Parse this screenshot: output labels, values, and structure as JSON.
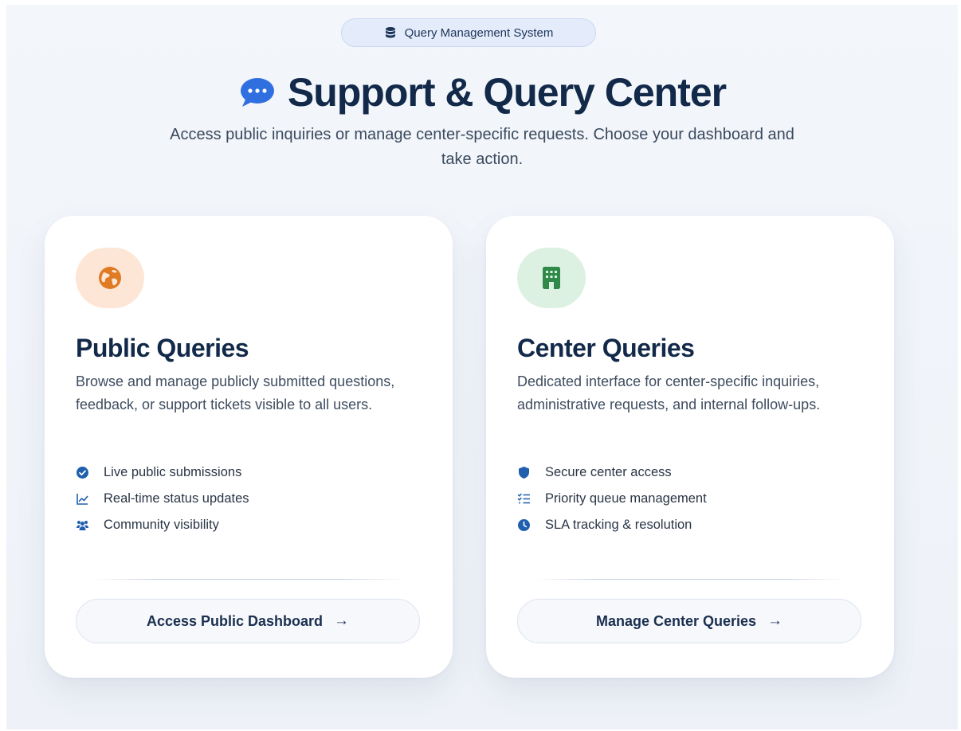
{
  "badge": {
    "label": "Query Management System",
    "icon": "database-icon"
  },
  "hero": {
    "title": "Support & Query Center",
    "icon": "chat-bubble-icon",
    "subtitle": "Access public inquiries or manage center-specific requests. Choose your dashboard and take action."
  },
  "cards": {
    "public": {
      "icon": "globe-icon",
      "title": "Public Queries",
      "description": "Browse and manage publicly submitted questions, feedback, or support tickets visible to all users.",
      "features": [
        {
          "icon": "check-circle-icon",
          "label": "Live public submissions"
        },
        {
          "icon": "line-chart-icon",
          "label": "Real-time status updates"
        },
        {
          "icon": "users-icon",
          "label": "Community visibility"
        }
      ],
      "button_label": "Access Public Dashboard",
      "button_arrow": "→"
    },
    "center": {
      "icon": "building-icon",
      "title": "Center Queries",
      "description": "Dedicated interface for center-specific inquiries, administrative requests, and internal follow-ups.",
      "features": [
        {
          "icon": "shield-icon",
          "label": "Secure center access"
        },
        {
          "icon": "checklist-icon",
          "label": "Priority queue management"
        },
        {
          "icon": "clock-icon",
          "label": "SLA tracking & resolution"
        }
      ],
      "button_label": "Manage Center Queries",
      "button_arrow": "→"
    }
  },
  "colors": {
    "heading": "#12294a",
    "accent_blue": "#2f6fe0",
    "orange": "#e07a23",
    "green": "#2f8a4a",
    "feature_icon": "#1f5fae"
  }
}
